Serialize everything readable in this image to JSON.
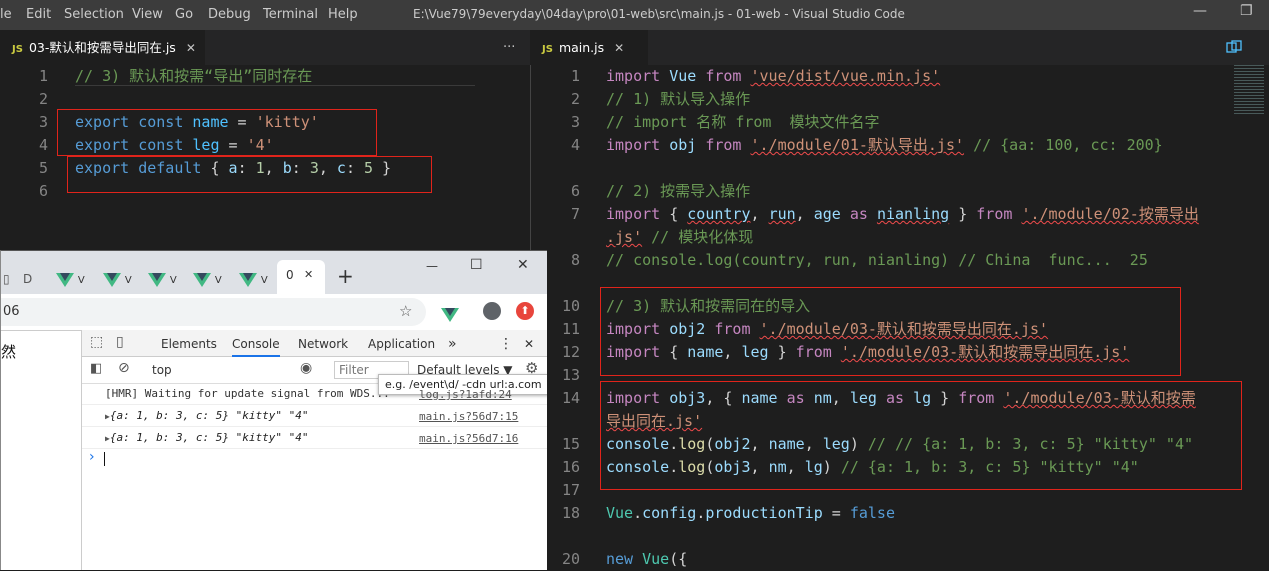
{
  "titlebar": {
    "menu": [
      "le",
      "Edit",
      "Selection",
      "View",
      "Go",
      "Debug",
      "Terminal",
      "Help"
    ],
    "title": "E:\\Vue79\\79everyday\\04day\\pro\\01-web\\src\\main.js - 01-web - Visual Studio Code",
    "minimize": "—",
    "restore": "❐"
  },
  "left_editor": {
    "tab": {
      "icon": "JS",
      "label": "03-默认和按需导出同在.js",
      "close": "✕"
    },
    "more": "···",
    "line_numbers": [
      "1",
      "2",
      "3",
      "4",
      "5",
      "6"
    ],
    "lines": [
      [
        [
          "com",
          "// 3) 默认和按需“导出”同时存在"
        ]
      ],
      [],
      [
        [
          "kw",
          "export"
        ],
        [
          "",
          " "
        ],
        [
          "kw",
          "const"
        ],
        [
          "",
          " "
        ],
        [
          "const",
          "name"
        ],
        [
          "",
          " = "
        ],
        [
          "str",
          "'kitty'"
        ]
      ],
      [
        [
          "kw",
          "export"
        ],
        [
          "",
          " "
        ],
        [
          "kw",
          "const"
        ],
        [
          "",
          " "
        ],
        [
          "const",
          "leg"
        ],
        [
          "",
          " = "
        ],
        [
          "str",
          "'4'"
        ]
      ],
      [
        [
          "kw",
          "export"
        ],
        [
          "",
          " "
        ],
        [
          "kw",
          "default"
        ],
        [
          "",
          " { "
        ],
        [
          "var",
          "a"
        ],
        [
          "",
          ": "
        ],
        [
          "num",
          "1"
        ],
        [
          "",
          ", "
        ],
        [
          "var",
          "b"
        ],
        [
          "",
          ": "
        ],
        [
          "num",
          "3"
        ],
        [
          "",
          ", "
        ],
        [
          "var",
          "c"
        ],
        [
          "",
          ": "
        ],
        [
          "num",
          "5"
        ],
        [
          "",
          " }"
        ]
      ],
      []
    ]
  },
  "right_editor": {
    "tab": {
      "icon": "JS",
      "label": "main.js",
      "close": "✕"
    },
    "line_numbers": [
      "1",
      "2",
      "3",
      "4",
      "",
      "6",
      "7",
      "",
      "8",
      "",
      "10",
      "11",
      "12",
      "13",
      "14",
      "",
      "15",
      "16",
      "17",
      "18",
      "",
      "20"
    ],
    "lines": [
      [
        [
          "kw2",
          "import"
        ],
        [
          "",
          " "
        ],
        [
          "var",
          "Vue"
        ],
        [
          "",
          " "
        ],
        [
          "kw2",
          "from"
        ],
        [
          "",
          " "
        ],
        [
          "str",
          "'vue/dist/vue.min.js'"
        ]
      ],
      [
        [
          "com",
          "// 1) 默认导入操作"
        ]
      ],
      [
        [
          "com",
          "// import 名称 from  模块文件名字"
        ]
      ],
      [
        [
          "kw2",
          "import"
        ],
        [
          "",
          " "
        ],
        [
          "var",
          "obj"
        ],
        [
          "",
          " "
        ],
        [
          "kw2",
          "from"
        ],
        [
          "",
          " "
        ],
        [
          "str",
          "'./module/01-默认导出.js'"
        ],
        [
          "",
          " "
        ],
        [
          "com",
          "// {aa: 100, cc: 200}"
        ]
      ],
      [],
      [
        [
          "com",
          "// 2) 按需导入操作"
        ]
      ],
      [
        [
          "kw2",
          "import"
        ],
        [
          "",
          " { "
        ],
        [
          "var",
          "country"
        ],
        [
          "",
          ", "
        ],
        [
          "var",
          "run"
        ],
        [
          "",
          ", "
        ],
        [
          "var",
          "age"
        ],
        [
          "",
          " "
        ],
        [
          "kw2",
          "as"
        ],
        [
          "",
          " "
        ],
        [
          "var",
          "nianling"
        ],
        [
          "",
          " } "
        ],
        [
          "kw2",
          "from"
        ],
        [
          "",
          " "
        ],
        [
          "str",
          "'./module/02-按需导出"
        ]
      ],
      [
        [
          "str",
          ".js'"
        ],
        [
          "",
          " "
        ],
        [
          "com",
          "// 模块化体现"
        ]
      ],
      [
        [
          "com",
          "// console.log(country, run, nianling) // China  func...  25"
        ]
      ],
      [],
      [
        [
          "com",
          "// 3) 默认和按需同在的导入"
        ]
      ],
      [
        [
          "kw2",
          "import"
        ],
        [
          "",
          " "
        ],
        [
          "var",
          "obj2"
        ],
        [
          "",
          " "
        ],
        [
          "kw2",
          "from"
        ],
        [
          "",
          " "
        ],
        [
          "str",
          "'./module/03-默认和按需导出同在.js'"
        ]
      ],
      [
        [
          "kw2",
          "import"
        ],
        [
          "",
          " { "
        ],
        [
          "var",
          "name"
        ],
        [
          "",
          ", "
        ],
        [
          "var",
          "leg"
        ],
        [
          "",
          " } "
        ],
        [
          "kw2",
          "from"
        ],
        [
          "",
          " "
        ],
        [
          "str",
          "'./module/03-默认和按需导出同在.js'"
        ]
      ],
      [],
      [
        [
          "kw2",
          "import"
        ],
        [
          "",
          " "
        ],
        [
          "var",
          "obj3"
        ],
        [
          "",
          ", { "
        ],
        [
          "var",
          "name"
        ],
        [
          "",
          " "
        ],
        [
          "kw2",
          "as"
        ],
        [
          "",
          " "
        ],
        [
          "var",
          "nm"
        ],
        [
          "",
          ", "
        ],
        [
          "var",
          "leg"
        ],
        [
          "",
          " "
        ],
        [
          "kw2",
          "as"
        ],
        [
          "",
          " "
        ],
        [
          "var",
          "lg"
        ],
        [
          "",
          " } "
        ],
        [
          "kw2",
          "from"
        ],
        [
          "",
          " "
        ],
        [
          "str",
          "'./module/03-默认和按需"
        ]
      ],
      [
        [
          "str",
          "导出同在.js'"
        ]
      ],
      [
        [
          "var",
          "console"
        ],
        [
          "",
          "."
        ],
        [
          "fn",
          "log"
        ],
        [
          "",
          "("
        ],
        [
          "var",
          "obj2"
        ],
        [
          "",
          ", "
        ],
        [
          "var",
          "name"
        ],
        [
          "",
          ", "
        ],
        [
          "var",
          "leg"
        ],
        [
          "",
          ") "
        ],
        [
          "com",
          "// // {a: 1, b: 3, c: 5} \"kitty\" \"4\""
        ]
      ],
      [
        [
          "var",
          "console"
        ],
        [
          "",
          "."
        ],
        [
          "fn",
          "log"
        ],
        [
          "",
          "("
        ],
        [
          "var",
          "obj3"
        ],
        [
          "",
          ", "
        ],
        [
          "var",
          "nm"
        ],
        [
          "",
          ", "
        ],
        [
          "var",
          "lg"
        ],
        [
          "",
          ") "
        ],
        [
          "com",
          "// {a: 1, b: 3, c: 5} \"kitty\" \"4\""
        ]
      ],
      [],
      [
        [
          "cls",
          "Vue"
        ],
        [
          "",
          "."
        ],
        [
          "var",
          "config"
        ],
        [
          "",
          "."
        ],
        [
          "var",
          "productionTip"
        ],
        [
          "",
          " = "
        ],
        [
          "kw",
          "false"
        ]
      ],
      [],
      [
        [
          "kw",
          "new"
        ],
        [
          "",
          " "
        ],
        [
          "cls",
          "Vue"
        ],
        [
          "",
          "({"
        ]
      ]
    ]
  },
  "browser": {
    "tabs": [
      "D",
      "V",
      "V",
      "V",
      "V",
      "V"
    ],
    "active_tab": "0",
    "tab_close": "✕",
    "new_tab": "+",
    "win_min": "—",
    "win_max": "☐",
    "win_close": "✕",
    "address": "06",
    "page_text": "然",
    "devtools": {
      "tabs": [
        "Elements",
        "Console",
        "Network",
        "Application"
      ],
      "more": "»",
      "menu": "⋮",
      "close": "✕",
      "context": "top",
      "filter_placeholder": "Filter",
      "levels": "Default levels ▼",
      "tooltip": "e.g. /event\\d/ -cdn url:a.com",
      "messages": [
        {
          "text": "[HMR] Waiting for update signal from WDS...",
          "source": "log.js?1afd:24"
        },
        {
          "text": "{a: 1, b: 3, c: 5} \"kitty\" \"4\"",
          "source": "main.js?56d7:15"
        },
        {
          "text": "{a: 1, b: 3, c: 5} \"kitty\" \"4\"",
          "source": "main.js?56d7:16"
        }
      ],
      "prompt": "›"
    }
  }
}
